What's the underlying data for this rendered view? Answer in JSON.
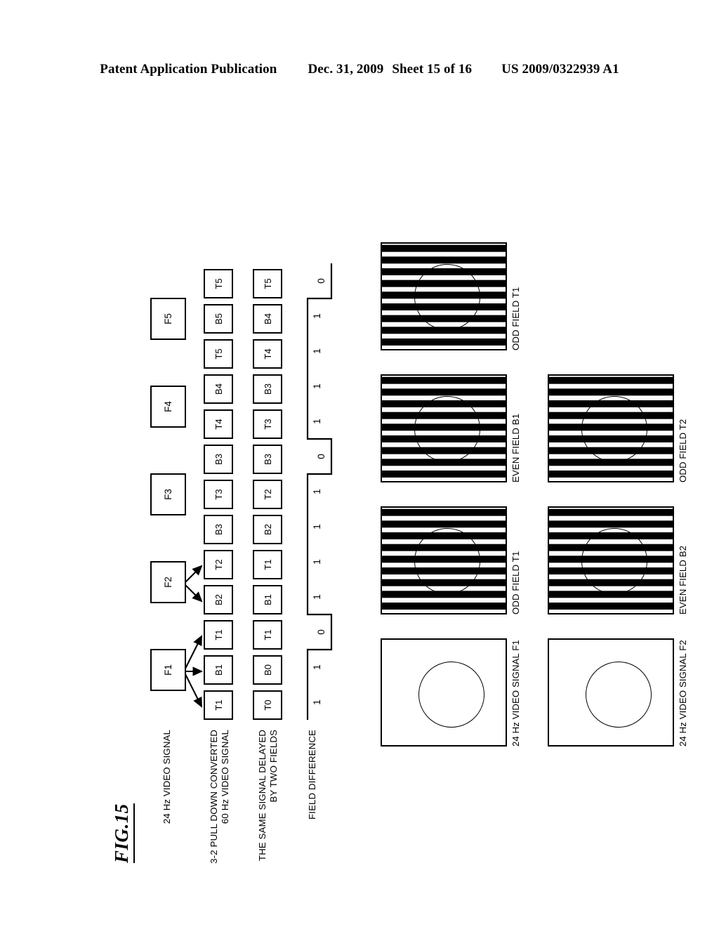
{
  "header": {
    "publication": "Patent Application Publication",
    "date": "Dec. 31, 2009",
    "sheet": "Sheet 15 of 16",
    "number": "US 2009/0322939 A1"
  },
  "figure": {
    "label": "FIG.15",
    "row_labels": {
      "source": "24 Hz VIDEO SIGNAL",
      "pulldown": "3-2 PULL DOWN CONVERTED\n60 Hz VIDEO SIGNAL",
      "delayed": "THE SAME SIGNAL DELAYED\nBY TWO FIELDS",
      "difference": "FIELD DIFFERENCE"
    },
    "frames": [
      "F1",
      "F2",
      "F3",
      "F4",
      "F5"
    ],
    "pulldown_fields": [
      "T1",
      "B1",
      "T1",
      "B2",
      "T2",
      "B3",
      "T3",
      "B3",
      "T4",
      "B4",
      "T5",
      "B5",
      "T5"
    ],
    "delayed_fields": [
      "T0",
      "B0",
      "T1",
      "B1",
      "T1",
      "B2",
      "T2",
      "B3",
      "T3",
      "B3",
      "T4",
      "B4",
      "T5"
    ],
    "field_difference": [
      "1",
      "1",
      "0",
      "1",
      "1",
      "1",
      "1",
      "0",
      "1",
      "1",
      "1",
      "1",
      "0"
    ],
    "pulldown_arrows": [
      {
        "from": "F1",
        "to": [
          "T1",
          "B1",
          "T1"
        ]
      },
      {
        "from": "F2",
        "to": [
          "B2",
          "T2"
        ]
      }
    ]
  },
  "panels": {
    "row1": [
      {
        "caption": "24 Hz VIDEO SIGNAL F1",
        "kind": "plain"
      },
      {
        "caption": "ODD FIELD T1",
        "kind": "striped"
      },
      {
        "caption": "EVEN FIELD B1",
        "kind": "striped"
      },
      {
        "caption": "ODD FIELD T1",
        "kind": "striped"
      }
    ],
    "row2": [
      {
        "caption": "24 Hz VIDEO SIGNAL F2",
        "kind": "plain"
      },
      {
        "caption": "EVEN FIELD B2",
        "kind": "striped"
      },
      {
        "caption": "ODD FIELD T2",
        "kind": "striped"
      }
    ]
  },
  "colors": {
    "ink": "#000000",
    "paper": "#ffffff"
  }
}
